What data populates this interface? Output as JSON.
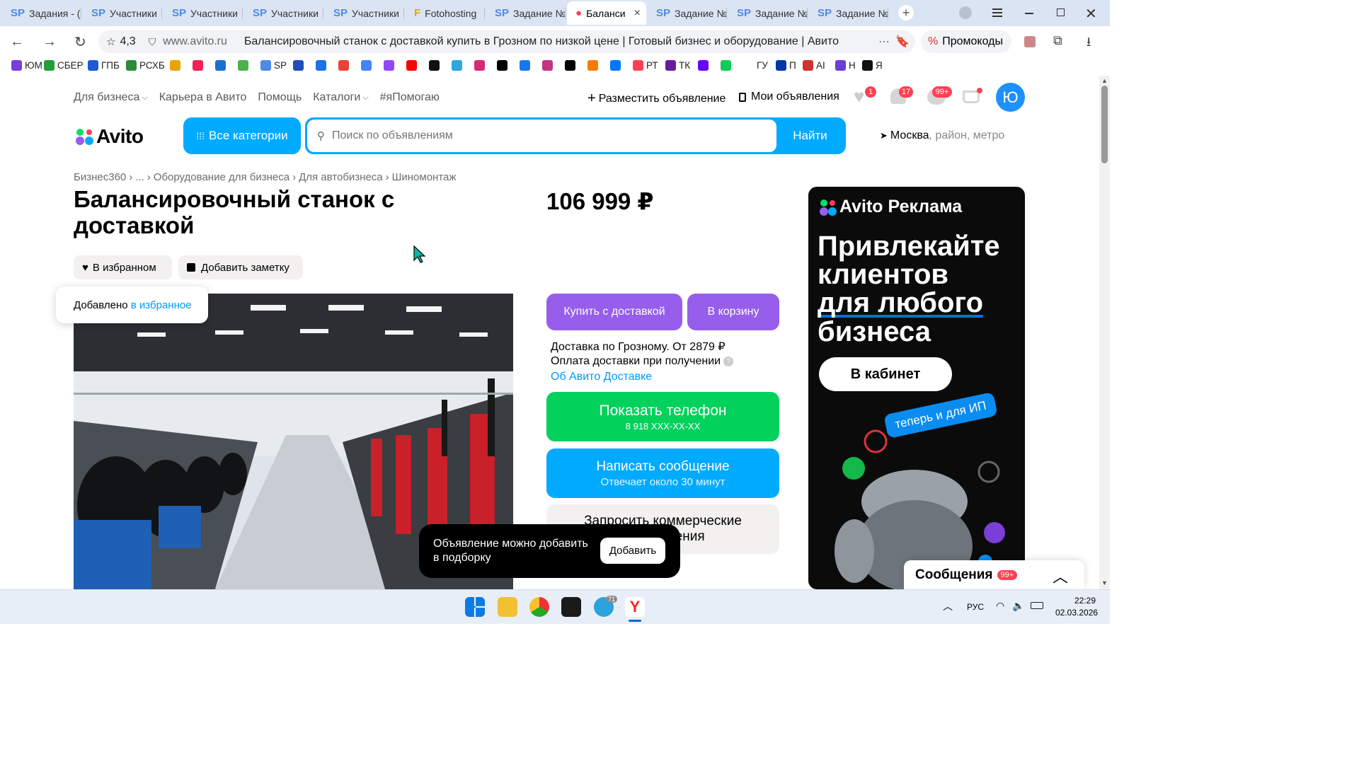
{
  "tabs": [
    {
      "fav": "SP",
      "label": "Задания - (",
      "active": false
    },
    {
      "fav": "SP",
      "label": "Участники",
      "active": false
    },
    {
      "fav": "SP",
      "label": "Участники",
      "active": false
    },
    {
      "fav": "SP",
      "label": "Участники",
      "active": false
    },
    {
      "fav": "SP",
      "label": "Участники",
      "active": false
    },
    {
      "fav": "F",
      "label": "Fotohosting",
      "active": false
    },
    {
      "fav": "SP",
      "label": "Задание №",
      "active": false
    },
    {
      "fav": "●",
      "label": "Баланси",
      "active": true
    },
    {
      "fav": "SP",
      "label": "Задание №",
      "active": false
    },
    {
      "fav": "SP",
      "label": "Задание №",
      "active": false
    },
    {
      "fav": "SP",
      "label": "Задание №",
      "active": false
    }
  ],
  "browser": {
    "rating": "4,3",
    "domain": "www.avito.ru",
    "page_title": "Балансировочный станок с доставкой купить в Грозном по низкой цене | Готовый бизнес и оборудование | Авито (78...",
    "promo": "Промокоды",
    "tab_close": "×",
    "new_tab": "+"
  },
  "bookmarks": [
    "ЮМ",
    "СБЕР",
    "ГПБ",
    "РСХБ",
    "",
    "",
    "",
    "",
    "SP",
    "",
    "",
    "",
    "",
    "",
    "",
    "",
    "",
    "",
    "",
    "",
    "",
    "",
    "",
    "",
    "РТ",
    "ТК",
    "",
    "",
    "ГУ",
    "П",
    "AI",
    "Н",
    "Я"
  ],
  "avito": {
    "topnav": {
      "business": "Для бизнеса",
      "career": "Карьера в Авито",
      "help": "Помощь",
      "catalogs": "Каталоги",
      "help_tag": "#яПомогаю",
      "post_ad": "Разместить объявление",
      "my_ads": "Мои объявления",
      "fav_count": "1",
      "notif_count": "17",
      "msg_count": "99+",
      "avatar_letter": "Ю"
    },
    "logo": "Avito",
    "all_categories": "Все категории",
    "search_placeholder": "Поиск по объявлениям",
    "search_button": "Найти",
    "location_city": "Москва",
    "location_rest": ", район, метро",
    "breadcrumbs": [
      "Бизнес360",
      "...",
      "Оборудование для бизнеса",
      "Для автобизнеса",
      "Шиномонтаж"
    ],
    "title": "Балансировочный станок с доставкой",
    "price": "106 999 ₽",
    "fav_button": "В избранном",
    "note_button": "Добавить заметку",
    "toast_text": "Добавлено ",
    "toast_link": "в избранное",
    "buy_delivery": "Купить с доставкой",
    "to_cart": "В корзину",
    "delivery_line": "Доставка по Грозному. От 2879 ₽",
    "payment_line": "Оплата доставки при получении",
    "about_delivery": "Об Авито Доставке",
    "show_phone": "Показать телефон",
    "phone_masked": "8 918 XXX-XX-XX",
    "write_msg": "Написать сообщение",
    "reply_time": "Отвечает около 30 минут",
    "request_offer_l1": "Запросить коммерческие",
    "request_offer_l2": "предложения",
    "collection_text_l1": "Объявление можно добавить",
    "collection_text_l2": "в подборку",
    "collection_add": "Добавить",
    "messages_panel": "Сообщения",
    "messages_badge": "99+"
  },
  "ad": {
    "brand": "Avito Реклама",
    "headline": [
      "Привлекайте",
      "клиентов",
      "для любого",
      "бизнеса"
    ],
    "cta": "В кабинет",
    "tag": "теперь и для ИП"
  },
  "taskbar": {
    "lang": "РУС",
    "time": "22:29",
    "date": "02.03.2026",
    "tg_badge": "71"
  },
  "colors": {
    "purple": "#965eeb",
    "green": "#02d15c",
    "blue": "#00aaff",
    "link": "#0099f7"
  }
}
